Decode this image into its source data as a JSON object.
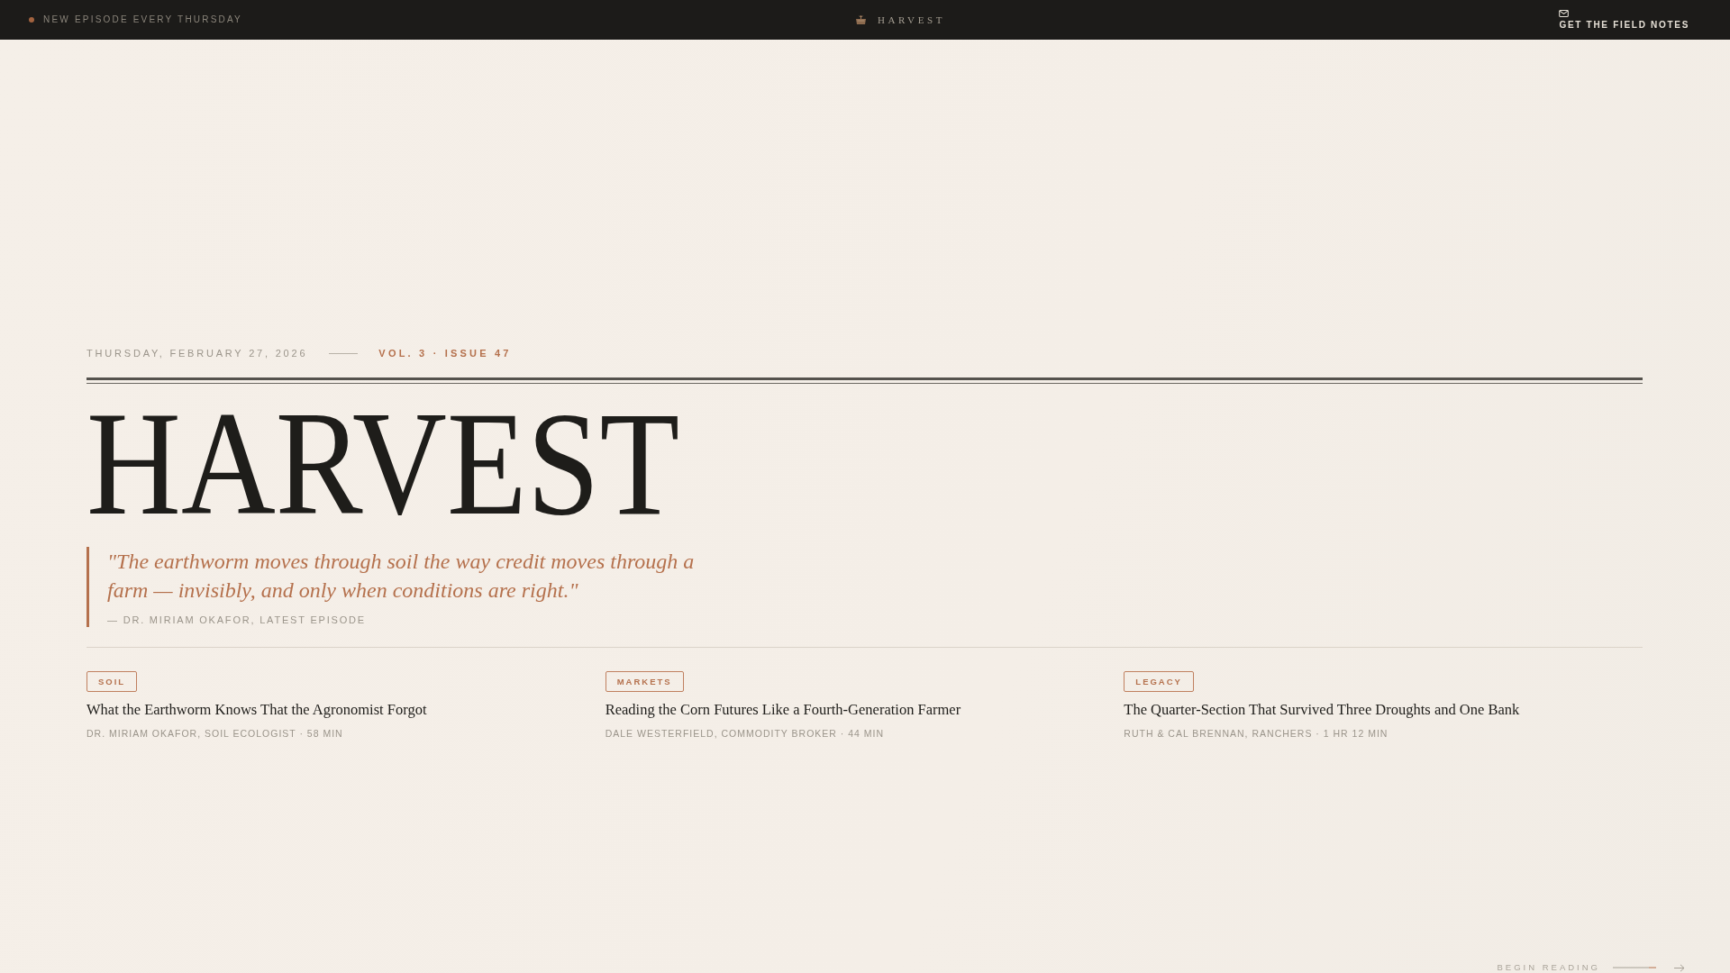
{
  "top_bar": {
    "announcement": "NEW EPISODE EVERY THURSDAY",
    "brand": "HARVEST",
    "cta": "GET THE FIELD NOTES"
  },
  "masthead": {
    "date": "THURSDAY, FEBRUARY 27, 2026",
    "issue": "VOL. 3 · ISSUE 47",
    "title": "HARVEST"
  },
  "pull_quote": {
    "text": "\"The earthworm moves through soil the way credit moves through a farm — invisibly, and only when conditions are right.\"",
    "attribution": "— DR. MIRIAM OKAFOR, LATEST EPISODE"
  },
  "episodes": [
    {
      "tag": "SOIL",
      "title": "What the Earthworm Knows That the Agronomist Forgot",
      "meta": "DR. MIRIAM OKAFOR, SOIL ECOLOGIST · 58 MIN"
    },
    {
      "tag": "MARKETS",
      "title": "Reading the Corn Futures Like a Fourth-Generation Farmer",
      "meta": "DALE WESTERFIELD, COMMODITY BROKER · 44 MIN"
    },
    {
      "tag": "LEGACY",
      "title": "The Quarter-Section That Survived Three Droughts and One Bank",
      "meta": "RUTH & CAL BRENNAN, RANCHERS · 1 HR 12 MIN"
    }
  ],
  "scroll_cue": {
    "label": "BEGIN READING"
  }
}
